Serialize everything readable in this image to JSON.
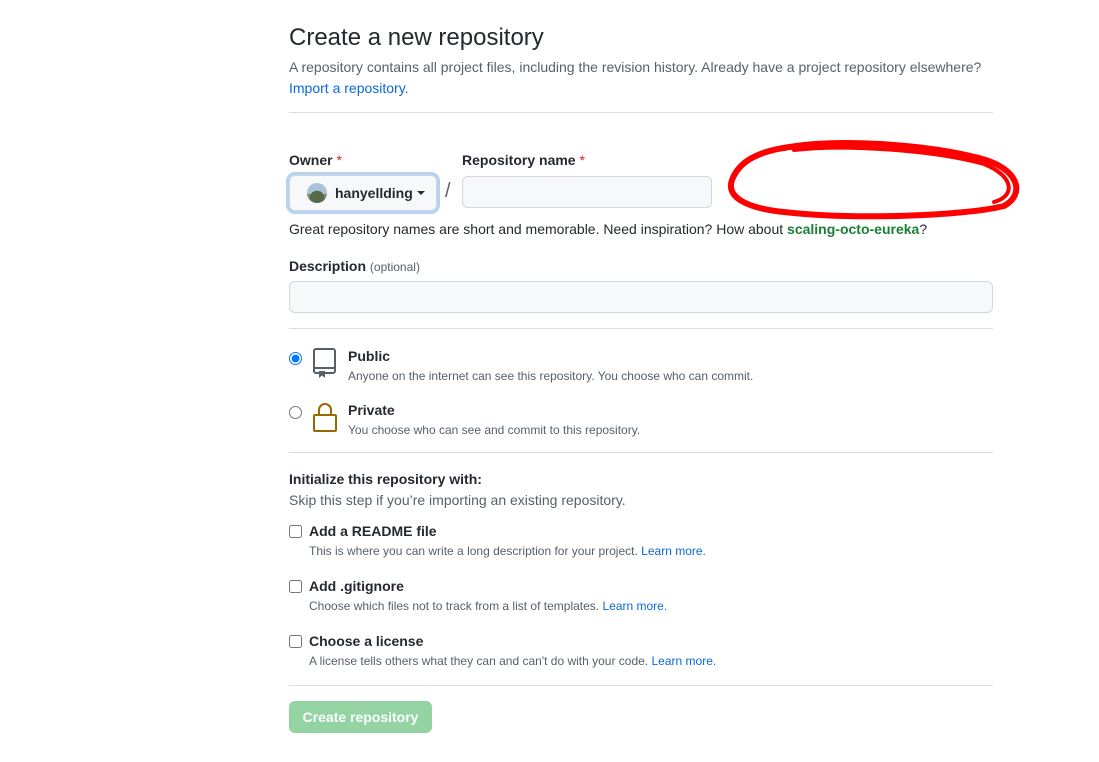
{
  "header": {
    "title": "Create a new repository",
    "subtitle": "A repository contains all project files, including the revision history. Already have a project repository elsewhere?",
    "import_link": "Import a repository",
    "import_suffix": "."
  },
  "owner": {
    "label": "Owner",
    "required_mark": "*",
    "value": "hanyellding"
  },
  "separator": "/",
  "repo_name": {
    "label": "Repository name",
    "required_mark": "*",
    "value": "",
    "placeholder": ""
  },
  "hint": {
    "text": "Great repository names are short and memorable. Need inspiration? How about",
    "suggestion": "scaling-octo-eureka",
    "suffix": "?"
  },
  "description": {
    "label": "Description",
    "optional": "(optional)",
    "value": ""
  },
  "visibility": {
    "selected": "public",
    "options": [
      {
        "title": "Public",
        "desc": "Anyone on the internet can see this repository. You choose who can commit.",
        "icon": "repo-icon"
      },
      {
        "title": "Private",
        "desc": "You choose who can see and commit to this repository.",
        "icon": "lock-icon"
      }
    ]
  },
  "init": {
    "title": "Initialize this repository with:",
    "subtitle": "Skip this step if you’re importing an existing repository.",
    "options": [
      {
        "title": "Add a README file",
        "desc": "This is where you can write a long description for your project.",
        "link": "Learn more."
      },
      {
        "title": "Add .gitignore",
        "desc": "Choose which files not to track from a list of templates.",
        "link": "Learn more."
      },
      {
        "title": "Choose a license",
        "desc": "A license tells others what they can and can't do with your code.",
        "link": "Learn more."
      }
    ]
  },
  "submit": {
    "label": "Create repository"
  },
  "colors": {
    "accent": "#0969da",
    "success": "#1a7f37",
    "annotation": "#ff0000",
    "button_disabled": "#94d3a2"
  }
}
